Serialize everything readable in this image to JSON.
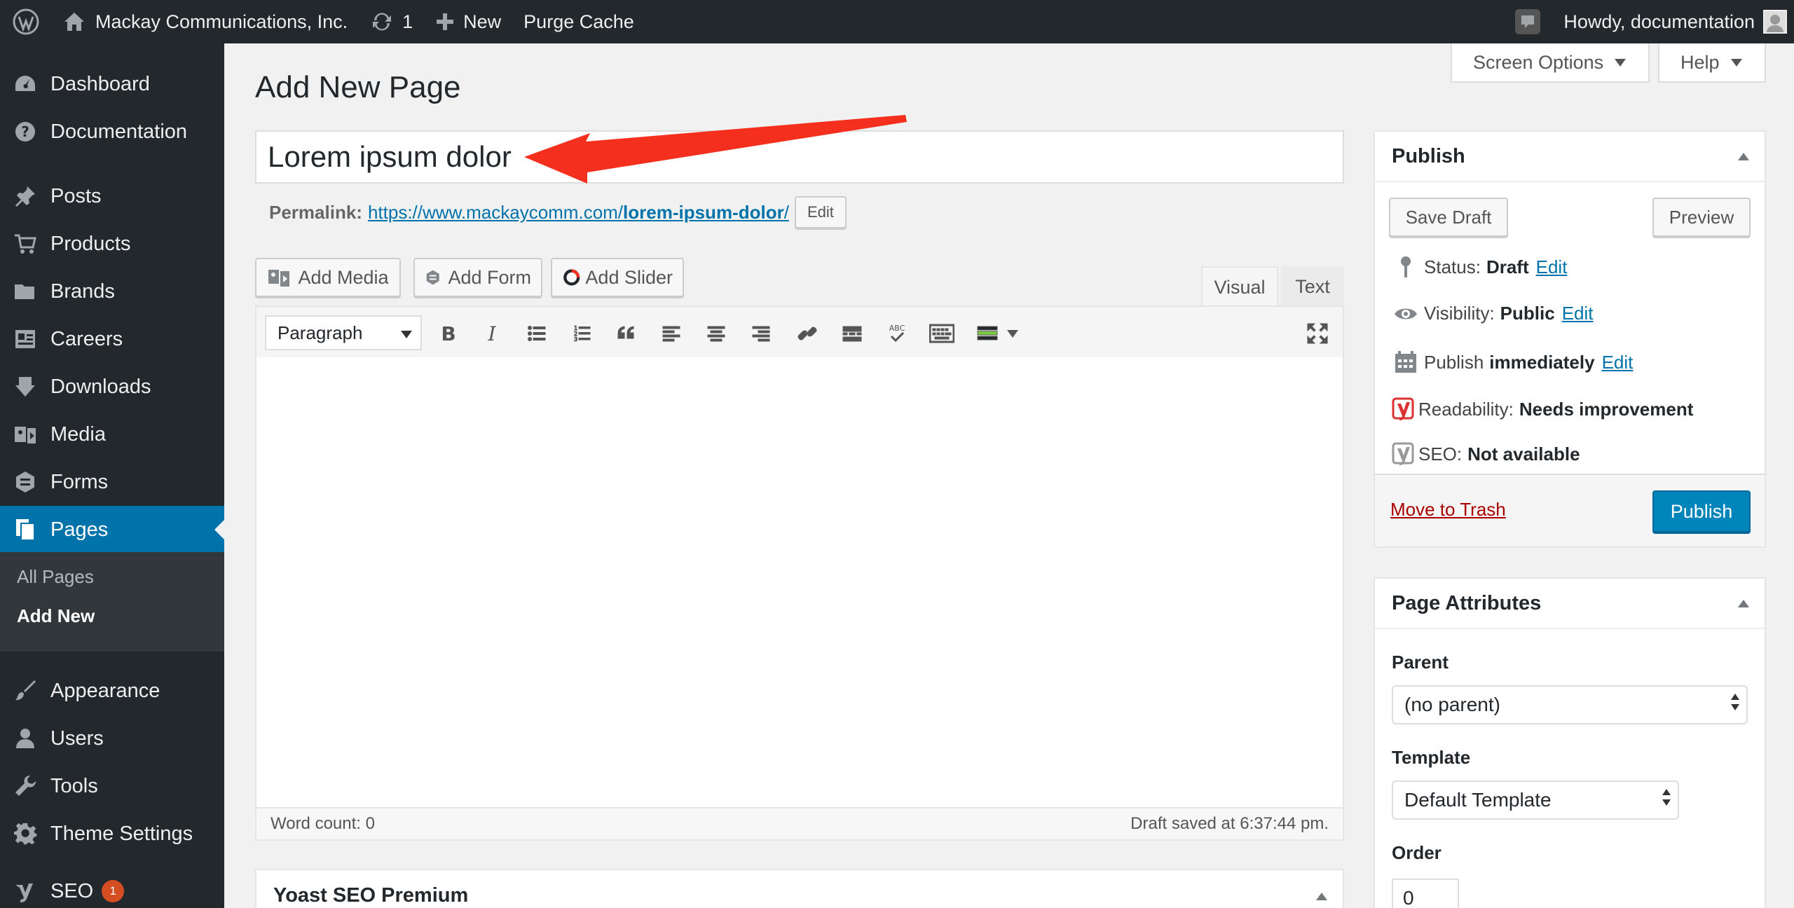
{
  "adminbar": {
    "site_name": "Mackay Communications, Inc.",
    "updates_count": "1",
    "new_label": "New",
    "purge_label": "Purge Cache",
    "howdy": "Howdy, documentation"
  },
  "sidebar": {
    "items": [
      {
        "label": "Dashboard",
        "icon": "dashboard-icon"
      },
      {
        "label": "Documentation",
        "icon": "help-icon"
      },
      {
        "label": "Posts",
        "icon": "pin-icon"
      },
      {
        "label": "Products",
        "icon": "cart-icon"
      },
      {
        "label": "Brands",
        "icon": "folder-icon"
      },
      {
        "label": "Careers",
        "icon": "id-card-icon"
      },
      {
        "label": "Downloads",
        "icon": "download-icon"
      },
      {
        "label": "Media",
        "icon": "media-icon"
      },
      {
        "label": "Forms",
        "icon": "forms-icon"
      },
      {
        "label": "Pages",
        "icon": "pages-icon"
      },
      {
        "label": "Appearance",
        "icon": "brush-icon"
      },
      {
        "label": "Users",
        "icon": "users-icon"
      },
      {
        "label": "Tools",
        "icon": "wrench-icon"
      },
      {
        "label": "Theme Settings",
        "icon": "gear-icon"
      },
      {
        "label": "SEO",
        "icon": "yoast-icon"
      }
    ],
    "seo_badge": "1",
    "submenu": {
      "all_pages": "All Pages",
      "add_new": "Add New"
    }
  },
  "header": {
    "title": "Add New Page",
    "screen_options": "Screen Options",
    "help": "Help"
  },
  "editor": {
    "post_title": "Lorem ipsum dolor",
    "permalink_label": "Permalink:",
    "permalink_base": "https://www.mackaycomm.com/",
    "permalink_slug": "lorem-ipsum-dolor",
    "permalink_trail": "/",
    "permalink_edit": "Edit",
    "add_media": "Add Media",
    "add_form": "Add Form",
    "add_slider": "Add Slider",
    "tab_visual": "Visual",
    "tab_text": "Text",
    "format": "Paragraph",
    "word_count": "Word count: 0",
    "draft_saved": "Draft saved at 6:37:44 pm."
  },
  "yoast": {
    "title": "Yoast SEO Premium"
  },
  "publish": {
    "title": "Publish",
    "save_draft": "Save Draft",
    "preview": "Preview",
    "status_label": "Status:",
    "status_value": "Draft",
    "visibility_label": "Visibility:",
    "visibility_value": "Public",
    "publish_label": "Publish",
    "publish_value": "immediately",
    "edit": "Edit",
    "readability_label": "Readability:",
    "readability_value": "Needs improvement",
    "seo_label": "SEO:",
    "seo_value": "Not available",
    "trash": "Move to Trash",
    "publish_button": "Publish"
  },
  "attributes": {
    "title": "Page Attributes",
    "parent_label": "Parent",
    "parent_value": "(no parent)",
    "template_label": "Template",
    "template_value": "Default Template",
    "order_label": "Order",
    "order_value": "0"
  },
  "colors": {
    "admin_dark": "#23282d",
    "accent_blue": "#0073aa",
    "annotation_red": "#f42f1e",
    "badge_orange": "#d54e21",
    "readability_red": "#dc3232"
  }
}
